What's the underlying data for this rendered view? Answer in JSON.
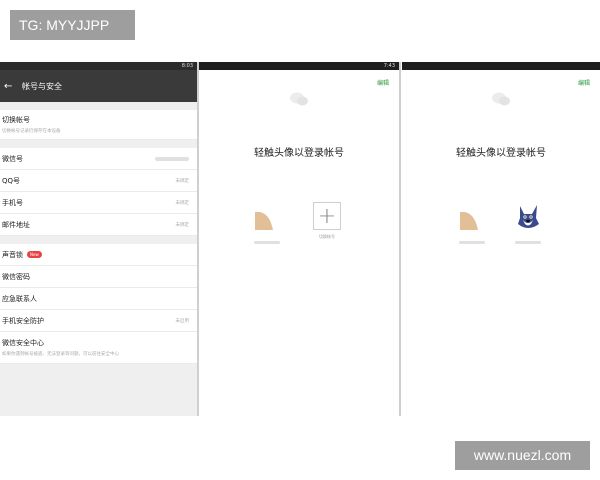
{
  "watermark_top_left": "TG: MYYJJPP",
  "watermark_bottom_right": "www.nuezl.com",
  "screen1": {
    "status_time": "8:03",
    "title": "帐号与安全",
    "switch_account": {
      "label": "切换帐号",
      "sub": "切换帐号记录仍保存在本设备"
    },
    "rows_group1": [
      {
        "label": "微信号",
        "value": ""
      },
      {
        "label": "QQ号",
        "value": "未绑定"
      },
      {
        "label": "手机号",
        "value": "未绑定"
      },
      {
        "label": "邮件地址",
        "value": "未绑定"
      }
    ],
    "voice_lock": {
      "label": "声音锁",
      "badge": "New"
    },
    "rows_group2": [
      {
        "label": "微信密码",
        "value": ""
      },
      {
        "label": "应急联系人",
        "value": ""
      },
      {
        "label": "手机安全防护",
        "value": "未启用"
      }
    ],
    "security_center": {
      "label": "微信安全中心",
      "sub": "如果你遇到帐号被盗、无法登录等问题，可以前往安全中心"
    }
  },
  "screen2": {
    "status_time": "7:43",
    "edit_label": "编辑",
    "title": "轻触头像以登录帐号",
    "add_account_label": "切换帐号"
  },
  "screen3": {
    "status_time": "",
    "edit_label": "编辑",
    "title": "轻触头像以登录帐号"
  },
  "colors": {
    "accent": "#2a9a3f",
    "badge": "#e64340",
    "titlebar": "#3a3a3a"
  }
}
